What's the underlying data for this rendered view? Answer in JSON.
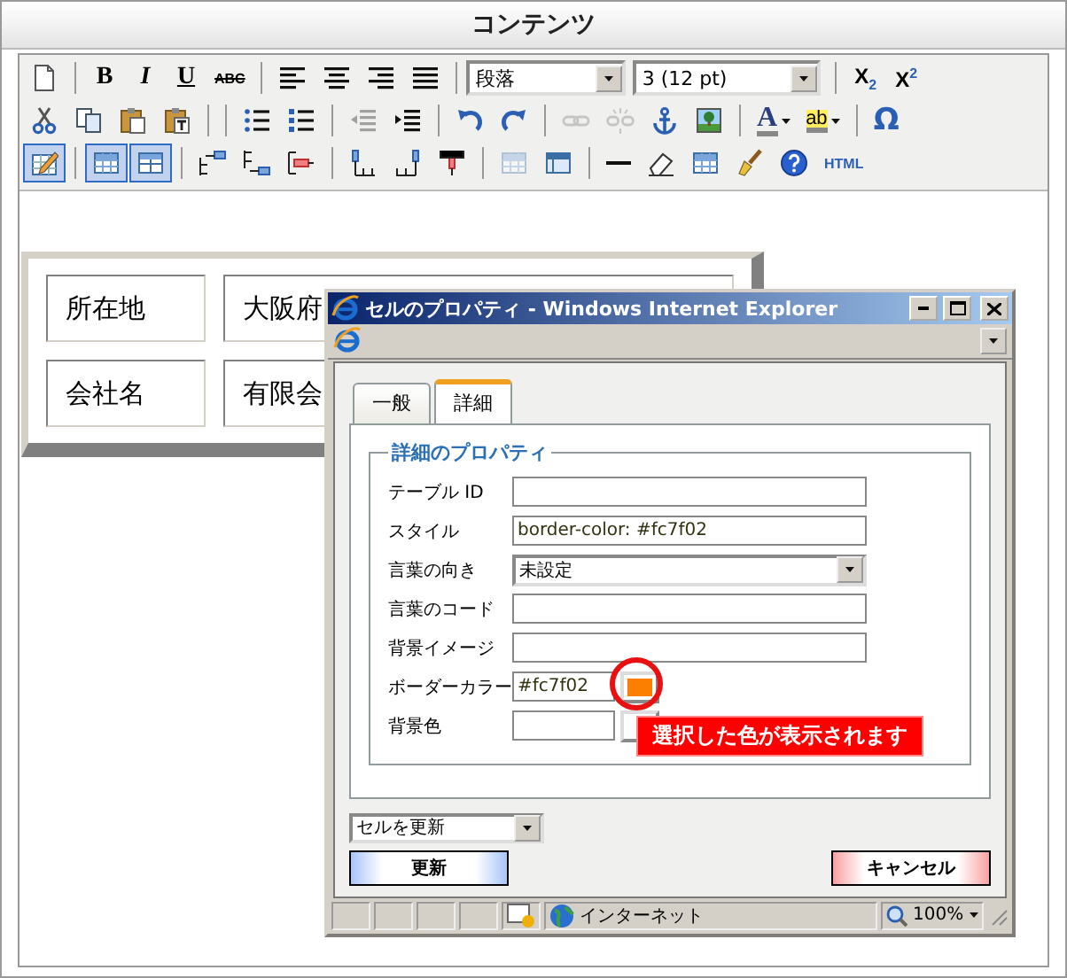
{
  "title": "コンテンツ",
  "toolbar": {
    "rows": [
      [
        {
          "kind": "button",
          "pressed": false,
          "disabled": false
        },
        {
          "kind": "separator"
        },
        {
          "kind": "button",
          "label": "B",
          "pressed": false,
          "disabled": false
        },
        {
          "kind": "button",
          "label": "I",
          "pressed": false,
          "disabled": false
        },
        {
          "kind": "button",
          "label": "U",
          "pressed": false,
          "disabled": false
        },
        {
          "kind": "button",
          "label": "ABC",
          "pressed": false,
          "disabled": false
        },
        {
          "kind": "separator"
        },
        {
          "kind": "button",
          "pressed": false,
          "disabled": false
        },
        {
          "kind": "button",
          "pressed": false,
          "disabled": false
        },
        {
          "kind": "button",
          "pressed": false,
          "disabled": false
        },
        {
          "kind": "button",
          "pressed": false,
          "disabled": false
        },
        {
          "kind": "separator"
        },
        {
          "kind": "select",
          "value": "段落"
        },
        {
          "kind": "select",
          "value": "3 (12 pt)"
        },
        {
          "kind": "separator"
        },
        {
          "kind": "button",
          "label": "X$_{2}$",
          "pressed": false,
          "disabled": false
        },
        {
          "kind": "button",
          "label": "X$^{2}$",
          "pressed": false,
          "disabled": false
        }
      ],
      [
        {
          "kind": "button",
          "pressed": false,
          "disabled": false
        },
        {
          "kind": "button",
          "pressed": false,
          "disabled": false
        },
        {
          "kind": "button",
          "pressed": false,
          "disabled": false
        },
        {
          "kind": "button",
          "pressed": false,
          "disabled": false
        },
        {
          "kind": "separator"
        },
        {
          "kind": "separator"
        },
        {
          "kind": "button",
          "pressed": false,
          "disabled": false
        },
        {
          "kind": "button",
          "pressed": false,
          "disabled": false
        },
        {
          "kind": "separator"
        },
        {
          "kind": "button",
          "pressed": false,
          "disabled": true
        },
        {
          "kind": "button",
          "pressed": false,
          "disabled": false
        },
        {
          "kind": "separator"
        },
        {
          "kind": "button",
          "pressed": false,
          "disabled": false
        },
        {
          "kind": "button",
          "pressed": false,
          "disabled": false
        },
        {
          "kind": "separator"
        },
        {
          "kind": "button",
          "pressed": false,
          "disabled": true
        },
        {
          "kind": "button",
          "pressed": false,
          "disabled": true
        },
        {
          "kind": "button",
          "pressed": false,
          "disabled": false
        },
        {
          "kind": "button",
          "pressed": false,
          "disabled": false
        },
        {
          "kind": "separator"
        },
        {
          "kind": "button",
          "label": "A",
          "pressed": false,
          "disabled": false
        },
        {
          "kind": "button",
          "label": "ab",
          "pressed": false,
          "disabled": false
        },
        {
          "kind": "separator"
        },
        {
          "kind": "button",
          "label": "Ω",
          "pressed": false,
          "disabled": false
        }
      ],
      [
        {
          "kind": "button",
          "pressed": true,
          "disabled": false
        },
        {
          "kind": "separator"
        },
        {
          "kind": "button",
          "pressed": true,
          "disabled": false
        },
        {
          "kind": "button",
          "pressed": true,
          "disabled": false
        },
        {
          "kind": "separator"
        },
        {
          "kind": "button",
          "pressed": false,
          "disabled": false
        },
        {
          "kind": "button",
          "pressed": false,
          "disabled": false
        },
        {
          "kind": "button",
          "pressed": false,
          "disabled": false
        },
        {
          "kind": "separator"
        },
        {
          "kind": "button",
          "pressed": false,
          "disabled": false
        },
        {
          "kind": "button",
          "pressed": false,
          "disabled": false
        },
        {
          "kind": "button",
          "pressed": false,
          "disabled": false
        },
        {
          "kind": "separator"
        },
        {
          "kind": "button",
          "pressed": false,
          "disabled": true
        },
        {
          "kind": "button",
          "pressed": false,
          "disabled": false
        },
        {
          "kind": "separator"
        },
        {
          "kind": "button",
          "pressed": false,
          "disabled": false
        },
        {
          "kind": "button",
          "pressed": false,
          "disabled": false
        },
        {
          "kind": "button",
          "pressed": false,
          "disabled": false
        },
        {
          "kind": "button",
          "pressed": false,
          "disabled": false
        },
        {
          "kind": "button",
          "pressed": false,
          "disabled": false
        },
        {
          "kind": "button",
          "label": "HTML",
          "pressed": false,
          "disabled": false
        }
      ]
    ]
  },
  "table": {
    "rows": [
      [
        "所在地",
        "大阪府"
      ],
      [
        "会社名",
        "有限会"
      ]
    ]
  },
  "dialog": {
    "title": "セルのプロパティ - Windows Internet Explorer",
    "tabs": [
      {
        "label": "一般",
        "selected": false
      },
      {
        "label": "詳細",
        "selected": true
      }
    ],
    "section": "詳細のプロパティ",
    "fields": [
      {
        "kind": "text",
        "label": "テーブル ID"
      },
      {
        "kind": "text",
        "label": "スタイル",
        "value": "border-color: #fc7f02"
      },
      {
        "kind": "select",
        "label": "言葉の向き",
        "value": "未設定"
      },
      {
        "kind": "text",
        "label": "言葉のコード"
      },
      {
        "kind": "text",
        "label": "背景イメージ"
      },
      {
        "kind": "color",
        "label": "ボーダーカラー",
        "value": "#fc7f02",
        "color": "#fc7f02"
      },
      {
        "kind": "color",
        "label": "背景色"
      }
    ],
    "callout": "選択した色が表示されます",
    "update_mode": "セルを更新",
    "buttons": [
      {
        "kind": "primary",
        "label": "更新"
      },
      {
        "kind": "cancel",
        "label": "キャンセル"
      }
    ],
    "status_bar": {
      "zone": "インターネット",
      "zoom": "100%"
    }
  }
}
